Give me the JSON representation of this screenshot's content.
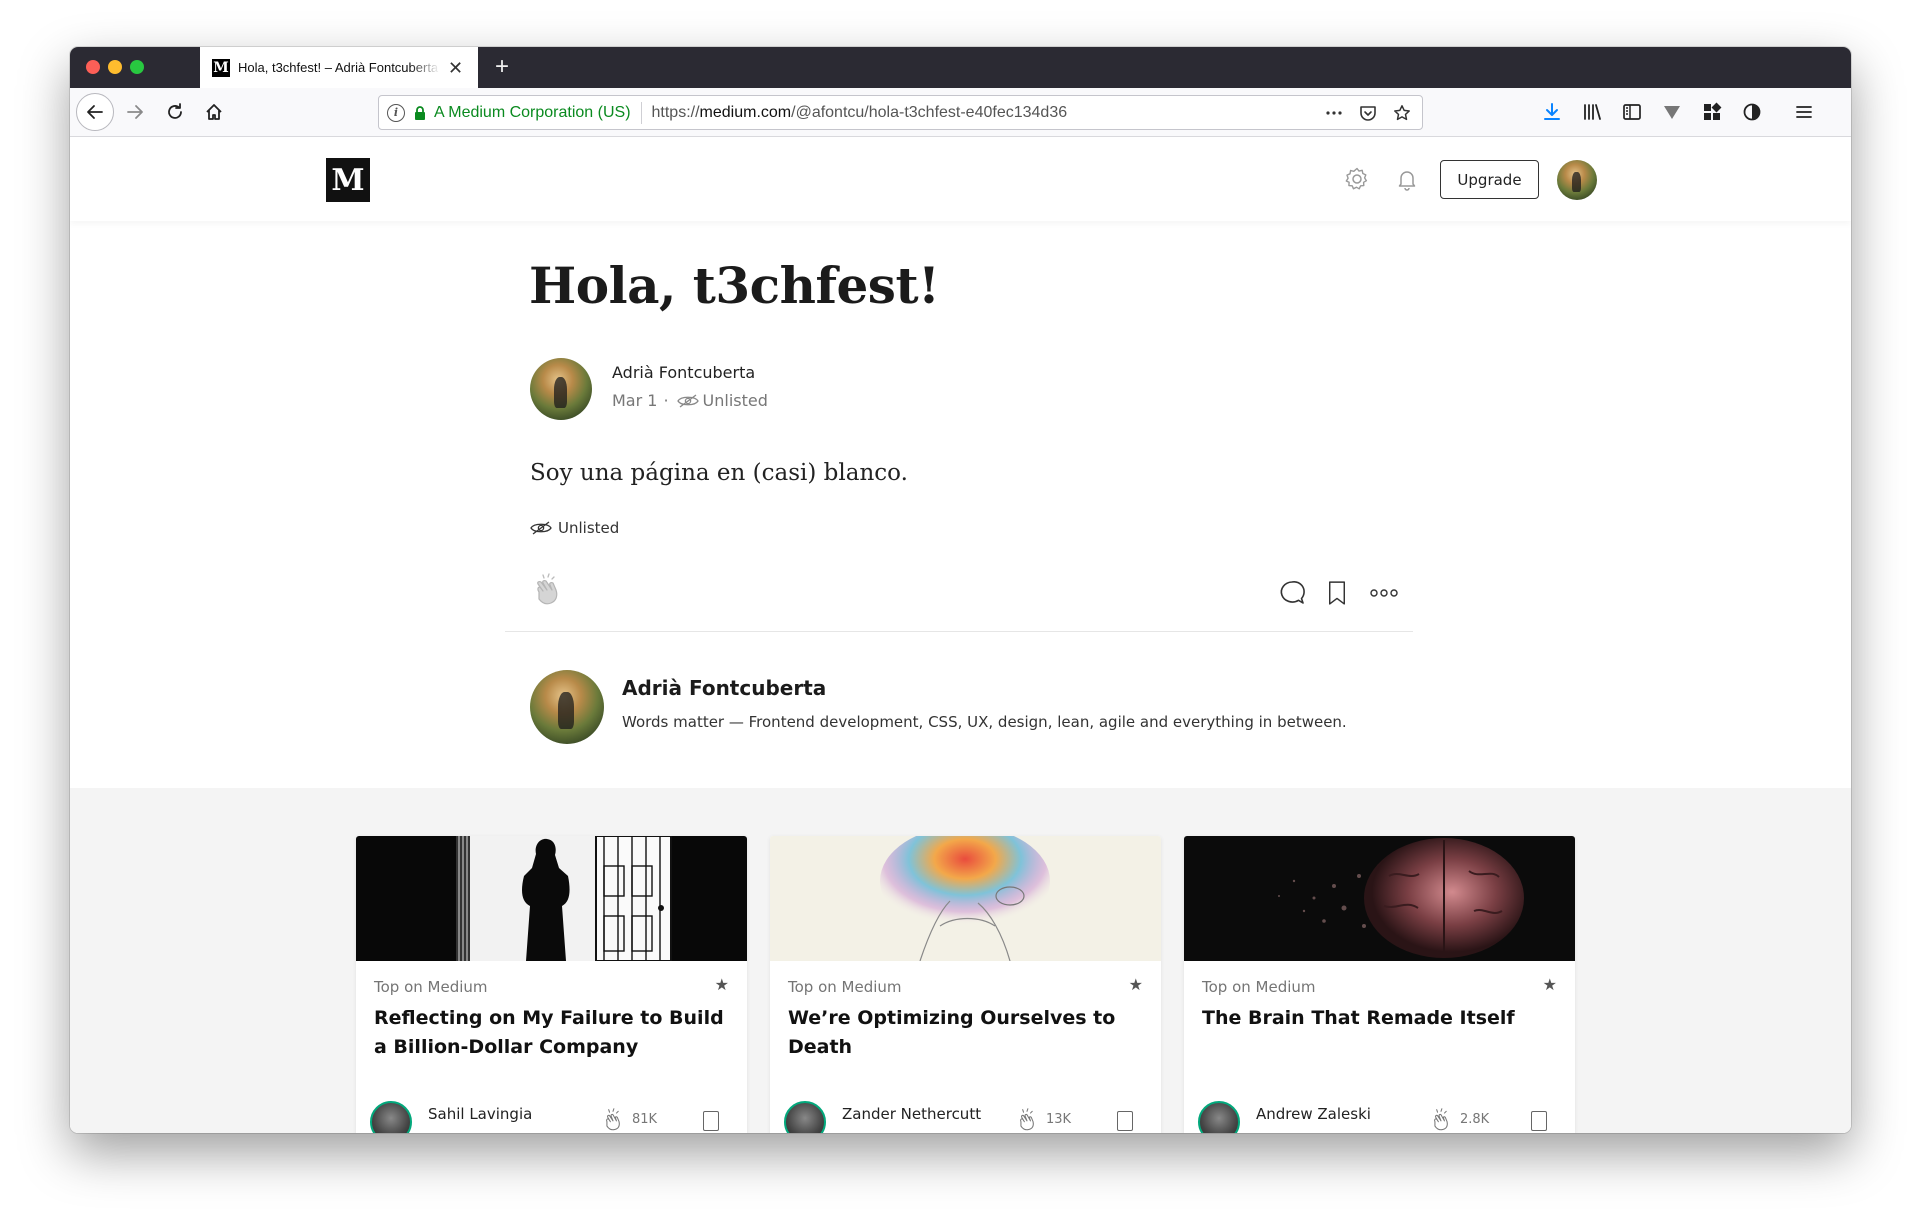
{
  "browser": {
    "tab": {
      "title": "Hola, t3chfest! – Adrià Fontcuberta",
      "favicon": "M",
      "close_icon": "close-icon"
    },
    "new_tab_label": "+",
    "url": {
      "identity": "A Medium Corporation (US)",
      "scheme": "https://",
      "domain": "medium.com",
      "path": "/@afontcu/hola-t3chfest-e40fec134d36"
    },
    "icons": [
      "back-icon",
      "forward-icon",
      "reload-icon",
      "home-icon",
      "info-icon",
      "lock-icon",
      "page-actions-icon",
      "pocket-icon",
      "star-icon",
      "download-icon",
      "library-icon",
      "sidebar-icon",
      "extension-icon",
      "apps-icon",
      "privacy-icon",
      "menu-icon"
    ],
    "colors": {
      "tabbar": "#2b2a33",
      "secure": "#0a8a1f",
      "download": "#0a84ff"
    }
  },
  "site": {
    "logo": "M",
    "upgrade_label": "Upgrade",
    "icons": [
      "gear-icon",
      "bell-icon",
      "avatar"
    ]
  },
  "article": {
    "title": "Hola, t3chfest!",
    "author": "Adrià Fontcuberta",
    "date": "Mar 1",
    "meta_sep": "·",
    "visibility": "Unlisted",
    "body": "Soy una página en (casi) blanco.",
    "tag": "Unlisted"
  },
  "bio": {
    "name": "Adrià Fontcuberta",
    "text": "Words matter — Frontend development, CSS, UX, design, lean, agile and everything in between."
  },
  "recommendations": [
    {
      "label": "Top on Medium",
      "star": "★",
      "title": "Reflecting on My Failure to Build a Billion-Dollar Company",
      "author": "Sahil Lavingia",
      "claps": "81K"
    },
    {
      "label": "Top on Medium",
      "star": "★",
      "title": "We’re Optimizing Ourselves to Death",
      "author": "Zander Nethercutt",
      "claps": "13K"
    },
    {
      "label": "Top on Medium",
      "star": "★",
      "title": "The Brain That Remade Itself",
      "author": "Andrew Zaleski",
      "claps": "2.8K"
    }
  ]
}
